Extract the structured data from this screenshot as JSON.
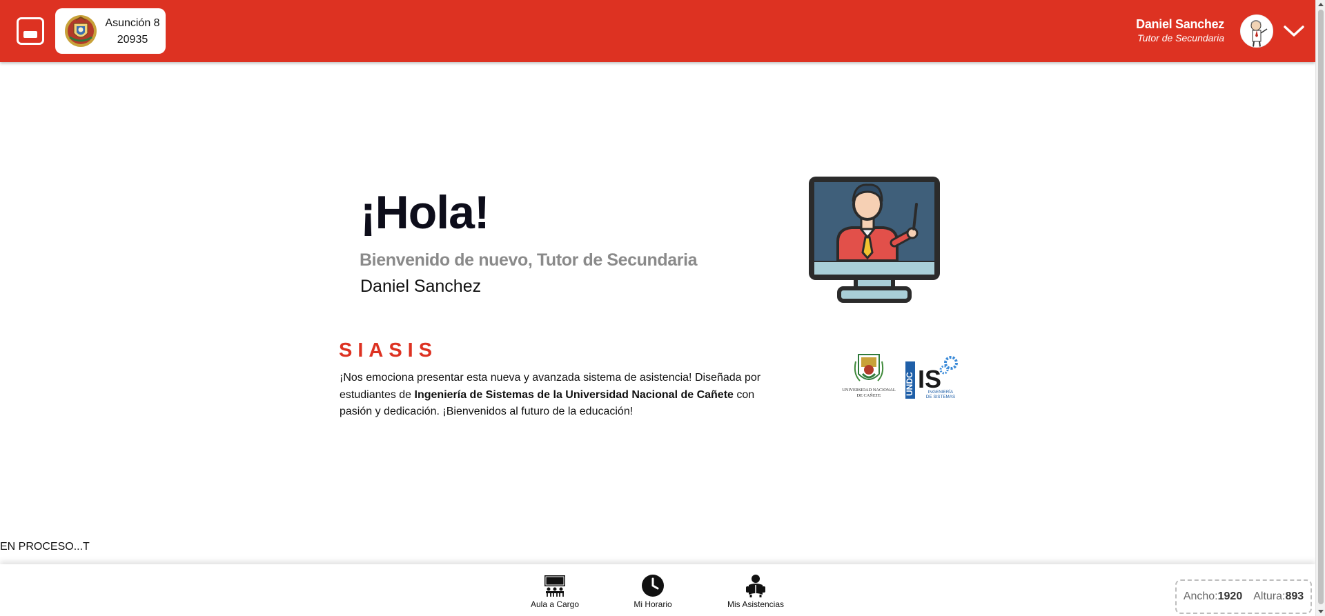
{
  "header": {
    "school_name": "Asunción 8",
    "school_code": "20935",
    "user_name": "Daniel Sanchez",
    "user_role": "Tutor de Secundaria",
    "brand_color": "#dd3222"
  },
  "hero": {
    "greeting": "¡Hola!",
    "welcome": "Bienvenido de nuevo, Tutor de Secundaria",
    "name": "Daniel Sanchez"
  },
  "about": {
    "title": "SIASIS",
    "desc_part1": "¡Nos emociona presentar esta nueva y avanzada sistema de asistencia! Diseñada por estudiantes de ",
    "desc_bold": "Ingeniería de Sistemas de la Universidad Nacional de Cañete",
    "desc_part2": " con pasión y dedicación. ¡Bienvenidos al futuro de la educación!",
    "logo_undc_text_1": "UNIVERSIDAD NACIONAL",
    "logo_undc_text_2": "DE CAÑETE",
    "logo_is_text_1": "INGENIERÍA",
    "logo_is_text_2": "DE SISTEMAS"
  },
  "status": "EN PROCESO...T",
  "bottom_nav": {
    "items": [
      {
        "label": "Aula a Cargo",
        "icon": "classroom-icon"
      },
      {
        "label": "Mi Horario",
        "icon": "clock-icon"
      },
      {
        "label": "Mis Asistencias",
        "icon": "reading-student-icon"
      }
    ]
  },
  "dimensions": {
    "width_label": "Ancho:",
    "width_value": "1920",
    "height_label": "Altura:",
    "height_value": "893"
  }
}
